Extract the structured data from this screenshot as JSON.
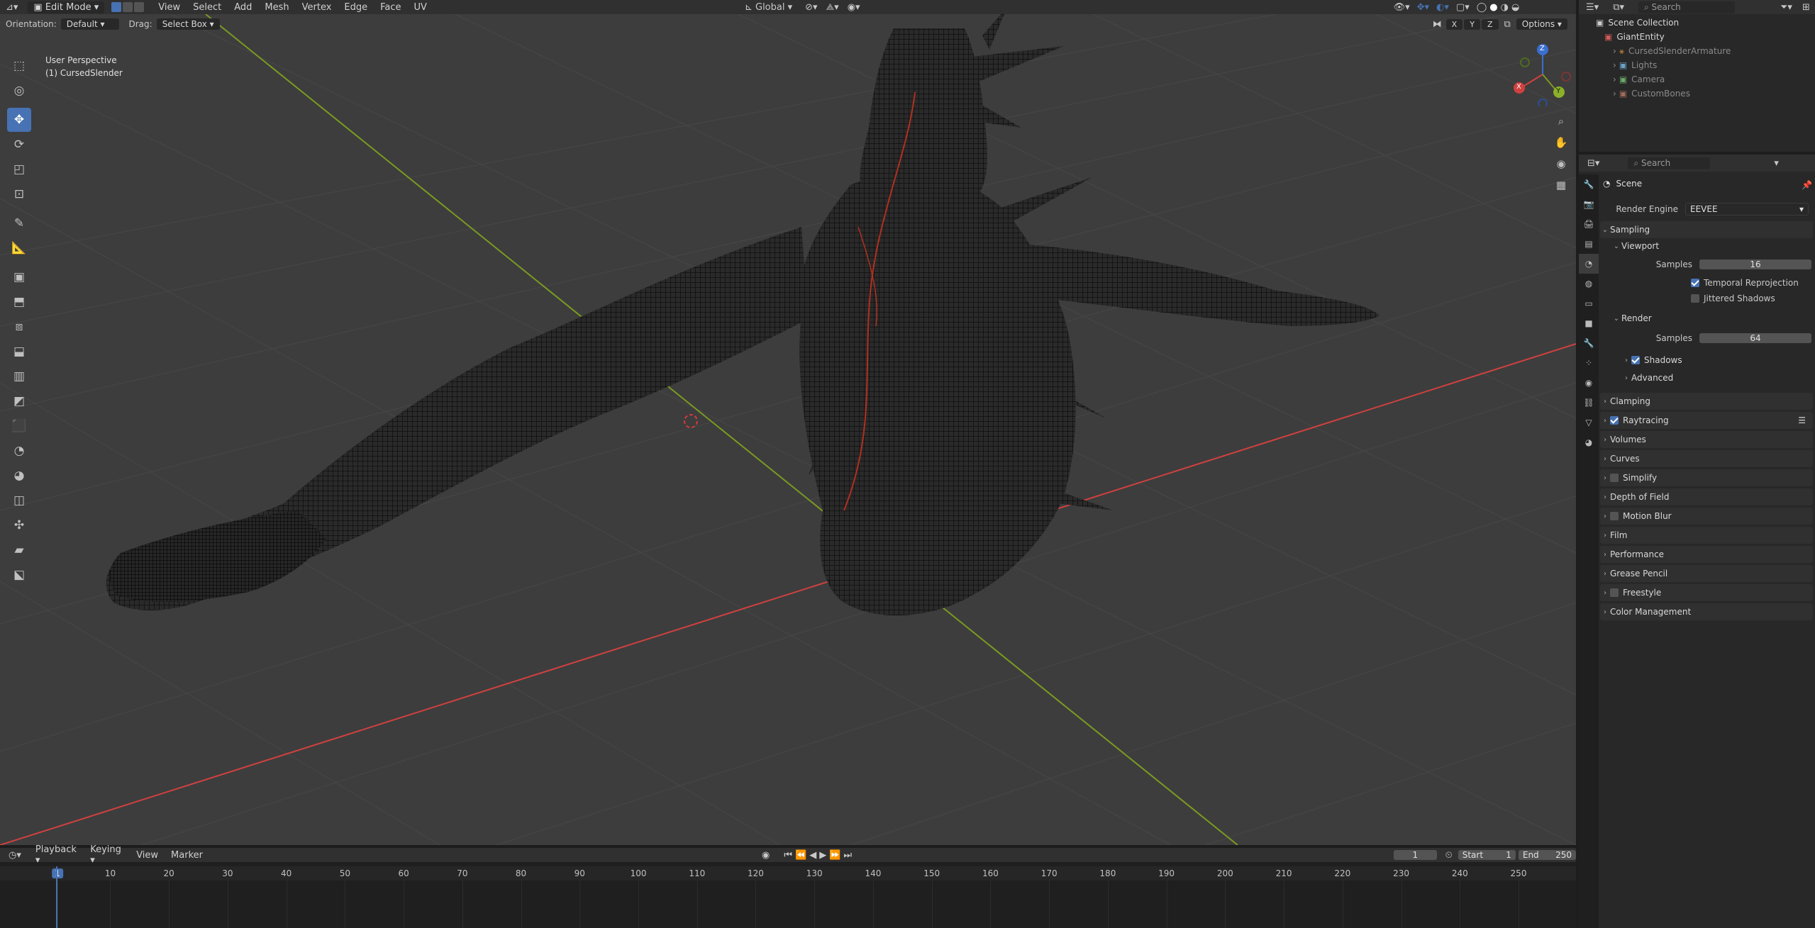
{
  "header": {
    "mode": "Edit Mode",
    "menus": [
      "View",
      "Select",
      "Add",
      "Mesh",
      "Vertex",
      "Edge",
      "Face",
      "UV"
    ],
    "transform_orientation": "Global",
    "options_label": "Options",
    "axis_labels": [
      "X",
      "Y",
      "Z"
    ]
  },
  "tool_settings": {
    "orientation_label": "Orientation:",
    "orientation_value": "Default",
    "drag_label": "Drag:",
    "drag_value": "Select Box"
  },
  "viewport": {
    "perspective": "User Perspective",
    "object_name": "(1) CursedSlender",
    "gizmo_axes": {
      "x": "X",
      "y": "Y",
      "z": "Z"
    }
  },
  "outliner": {
    "search_placeholder": "Search",
    "items": [
      {
        "label": "Scene Collection",
        "dim": false
      },
      {
        "label": "GiantEntity",
        "dim": false
      },
      {
        "label": "CursedSlenderArmature",
        "dim": true
      },
      {
        "label": "Lights",
        "dim": true
      },
      {
        "label": "Camera",
        "dim": true
      },
      {
        "label": "CustomBones",
        "dim": true
      }
    ]
  },
  "properties": {
    "search_placeholder": "Search",
    "context": "Scene",
    "render_engine_label": "Render Engine",
    "render_engine_value": "EEVEE",
    "sampling": {
      "title": "Sampling",
      "viewport": {
        "title": "Viewport",
        "samples_label": "Samples",
        "samples_value": "16",
        "temporal_reprojection": "Temporal Reprojection",
        "jittered_shadows": "Jittered Shadows"
      },
      "render": {
        "title": "Render",
        "samples_label": "Samples",
        "samples_value": "64",
        "shadows": "Shadows",
        "advanced": "Advanced"
      }
    },
    "panels": [
      "Clamping",
      "Raytracing",
      "Volumes",
      "Curves",
      "Simplify",
      "Depth of Field",
      "Motion Blur",
      "Film",
      "Performance",
      "Grease Pencil",
      "Freestyle",
      "Color Management"
    ],
    "checkbox_panels": {
      "Raytracing": true,
      "Simplify": false,
      "Motion Blur": false,
      "Freestyle": false
    },
    "temporal_reprojection_on": true,
    "jittered_shadows_on": false,
    "shadows_on": true
  },
  "timeline": {
    "menus": [
      "Playback",
      "Keying",
      "View",
      "Marker"
    ],
    "current_frame": "1",
    "start_label": "Start",
    "start_value": "1",
    "end_label": "End",
    "end_value": "250",
    "ticks": [
      "1",
      "10",
      "20",
      "30",
      "40",
      "50",
      "60",
      "70",
      "80",
      "90",
      "100",
      "110",
      "120",
      "130",
      "140",
      "150",
      "160",
      "170",
      "180",
      "190",
      "200",
      "210",
      "220",
      "230",
      "240",
      "250"
    ]
  },
  "colors": {
    "accent": "#4772b3",
    "x_axis": "#d0413f",
    "y_axis": "#7a9a21",
    "frame_marker": "#4772b3"
  }
}
